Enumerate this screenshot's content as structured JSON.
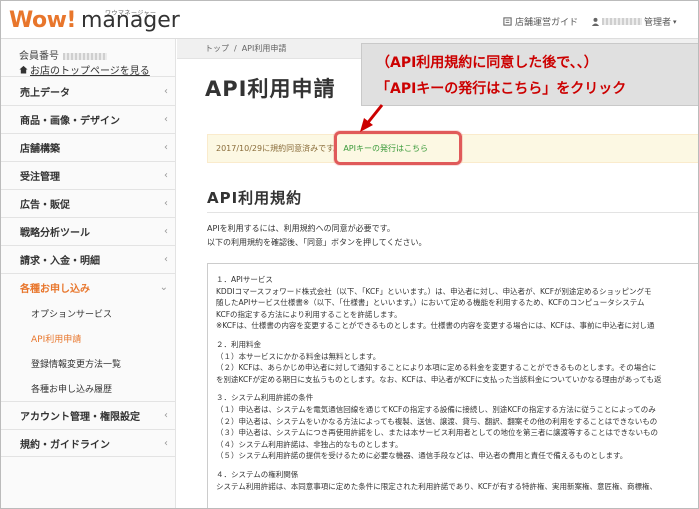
{
  "header": {
    "logo_main": "Wow!",
    "logo_sub": "manager",
    "logo_ruby": "ワウマネージャー",
    "guide_label": "店舗運営ガイド",
    "user_suffix": "管理者"
  },
  "sidebar": {
    "member_label": "会員番号",
    "top_link": "お店のトップページを見る",
    "items": [
      {
        "label": "売上データ"
      },
      {
        "label": "商品・画像・デザイン"
      },
      {
        "label": "店舗構築"
      },
      {
        "label": "受注管理"
      },
      {
        "label": "広告・販促"
      },
      {
        "label": "戦略分析ツール"
      },
      {
        "label": "請求・入金・明細"
      },
      {
        "label": "各種お申し込み"
      },
      {
        "label": "アカウント管理・権限設定"
      },
      {
        "label": "規約・ガイドライン"
      }
    ],
    "subitems": [
      {
        "label": "オプションサービス"
      },
      {
        "label": "API利用申請"
      },
      {
        "label": "登録情報変更方法一覧"
      },
      {
        "label": "各種お申し込み履歴"
      }
    ]
  },
  "breadcrumb": {
    "home": "トップ",
    "sep": "/",
    "current": "API利用申請"
  },
  "main": {
    "title": "API利用申請",
    "notice_text": "2017/10/29に規約同意済みです。",
    "notice_link": "APIキーの発行はこちら",
    "section_title": "API利用規約",
    "intro_line1": "APIを利用するには、利用規約への同意が必要です。",
    "intro_line2": "以下の利用規約を確認後、「同意」ボタンを押してください。"
  },
  "callout": {
    "line1": "（API利用規約に同意した後で、、）",
    "line2": "「APIキーの発行はこちら」をクリック",
    "color": "#cc0000"
  },
  "terms": {
    "s1_title": "１．APIサービス",
    "s1_l1": "KDDIコマースフォワード株式会社（以下、「KCF」といいます。）は、申込者に対し、申込者が、KCFが別途定めるショッピングモ",
    "s1_l2": "随したAPIサービス仕様書※（以下、「仕様書」といいます。）において定める機能を利用するため、KCFのコンピュータシステム",
    "s1_l3": "KCFの指定する方法により利用することを許諾します。",
    "s1_l4": "※KCFは、仕様書の内容を変更することができるものとします。仕様書の内容を変更する場合には、KCFは、事前に申込者に対し通",
    "s2_title": "２．利用料金",
    "s2_l1": "（１）本サービスにかかる料金は無料とします。",
    "s2_l2": "（２）KCFは、あらかじめ申込者に対して通知することにより本項に定める料金を変更することができるものとします。その場合に",
    "s2_l3": "を別途KCFが定める期日に支払うものとします。なお、KCFは、申込者がKCFに支払った当該料金についていかなる理由があっても返",
    "s3_title": "３．システム利用許諾の条件",
    "s3_l1": "（１）申込者は、システムを電気通信回線を通じてKCFの指定する設備に接続し、別途KCFの指定する方法に従うことによってのみ",
    "s3_l2": "（２）申込者は、システムをいかなる方法によっても複製、送信、譲渡、貸与、翻訳、翻案その他の利用をすることはできないもの",
    "s3_l3": "（３）申込者は、システムにつき再使用許諾をし、または本サービス利用者としての地位を第三者に譲渡等することはできないもの",
    "s3_l4": "（４）システム利用許諾は、非独占的なものとします。",
    "s3_l5": "（５）システム利用許諾の提供を受けるために必要な機器、通信手段などは、申込者の費用と責任で備えるものとします。",
    "s4_title": "４．システムの権利関係",
    "s4_l1": "システム利用許諾は、本同意事項に定めた条件に限定された利用許諾であり、KCFが有する特許権、実用新案権、意匠権、商標権、"
  },
  "colors": {
    "brand_orange": "#e8762c",
    "highlight_border": "#e05a5a",
    "notice_bg": "#fcf8e3",
    "link_green": "#3a9a3a"
  }
}
